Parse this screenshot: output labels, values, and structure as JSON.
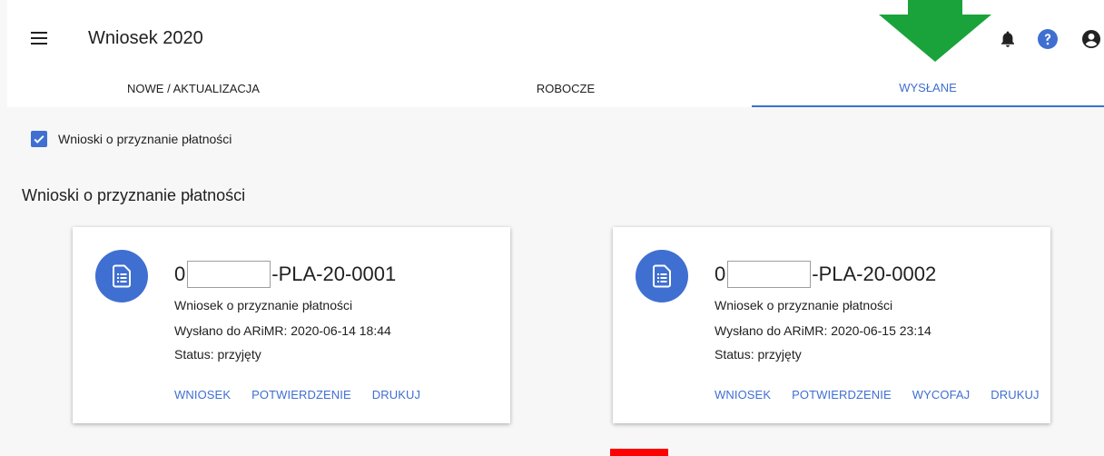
{
  "app": {
    "title": "Wniosek 2020"
  },
  "tabs": [
    {
      "label": "NOWE / AKTUALIZACJA"
    },
    {
      "label": "ROBOCZE"
    },
    {
      "label": "WYSŁANE"
    }
  ],
  "active_tab": "WYSŁANE",
  "filter": {
    "label": "Wnioski o przyznanie płatności",
    "checked": true
  },
  "section": {
    "title": "Wnioski o przyznanie płatności"
  },
  "cards": [
    {
      "id_prefix": "0",
      "id_suffix": "-PLA-20-0001",
      "type": "Wniosek o przyznanie płatności",
      "sent": "Wysłano do ARiMR: 2020-06-14 18:44",
      "status": "Status: przyjęty",
      "actions": [
        "WNIOSEK",
        "POTWIERDZENIE",
        "DRUKUJ"
      ]
    },
    {
      "id_prefix": "0",
      "id_suffix": "-PLA-20-0002",
      "type": "Wniosek o przyznanie płatności",
      "sent": "Wysłano do ARiMR: 2020-06-15 23:14",
      "status": "Status: przyjęty",
      "actions": [
        "WNIOSEK",
        "POTWIERDZENIE",
        "WYCOFAJ",
        "DRUKUJ"
      ]
    }
  ],
  "icons": {
    "menu": "hamburger-menu-icon",
    "notifications": "bell-icon",
    "help": "help-icon",
    "account": "account-circle-icon",
    "document": "document-list-icon"
  },
  "colors": {
    "accent": "#3f6fd1",
    "annotation_arrow": "#1aa33b",
    "annotation_block": "#ff0000"
  }
}
